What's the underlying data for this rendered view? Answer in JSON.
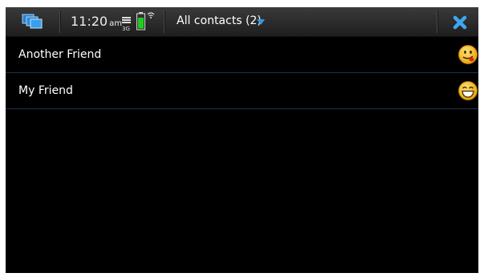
{
  "statusbar": {
    "time": "11:20",
    "ampm": "am",
    "network": "3G",
    "menu_title": "All contacts (2)"
  },
  "icons": {
    "task_switcher": "task-switcher-icon",
    "close": "close-icon",
    "menu_caret": "chevron-down-icon"
  },
  "colors": {
    "accent": "#2f9ae0",
    "divider": "#1d3349",
    "background": "#000000"
  },
  "contacts": [
    {
      "name": "Another Friend",
      "status_icon": "tongue-smiley-icon"
    },
    {
      "name": "My Friend",
      "status_icon": "grin-smiley-icon"
    }
  ]
}
